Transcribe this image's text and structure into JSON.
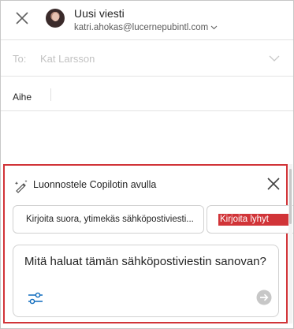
{
  "header": {
    "title": "Uusi viesti",
    "sender": "katri.ahokas@lucernepubintl.com",
    "icons": {
      "close": "close-icon",
      "avatar": "avatar",
      "sender_dropdown": "chevron-down-icon"
    }
  },
  "to": {
    "label": "To:",
    "value": "Kat Larsson"
  },
  "subject": {
    "label": "Aihe"
  },
  "copilot": {
    "title": "Luonnostele Copilotin avulla",
    "suggestions": [
      "Kirjoita suora, ytimekäs sähköpostiviesti...",
      "Kirjoita lyhyt"
    ],
    "prompt_placeholder": "Mitä haluat tämän sähköpostiviestin sanovan?",
    "icons": {
      "copilot": "copilot-pen-icon",
      "close": "close-icon",
      "settings": "settings-sliders-icon",
      "send": "send-arrow-icon"
    },
    "colors": {
      "highlight": "#d13438",
      "border": "#d13438"
    }
  }
}
